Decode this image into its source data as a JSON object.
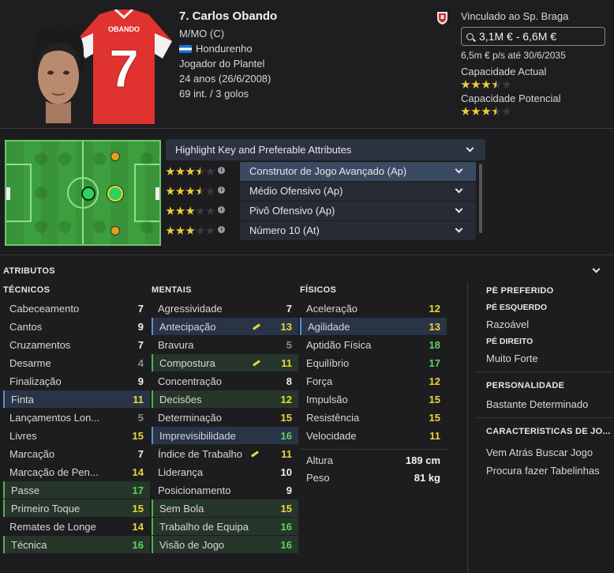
{
  "player": {
    "name": "7. Carlos Obando",
    "position": "M/MO (C)",
    "nationality": "Hondurenho",
    "status": "Jogador do Plantel",
    "age": "24 anos (26/6/2008)",
    "caps": "69 int. / 3 golos",
    "shirt_name": "OBANDO",
    "shirt_number": "7"
  },
  "contract": {
    "club_label": "Vinculado ao Sp. Braga",
    "value": "3,1M € - 6,6M €",
    "wage": "6,5m € p/s até 30/6/2035",
    "current_ability_label": "Capacidade Actual",
    "current_ability_stars": 3.5,
    "potential_ability_label": "Capacidade Potencial",
    "potential_ability_stars": 3.5
  },
  "roles": {
    "header": "Highlight Key and Preferable Attributes",
    "items": [
      {
        "name": "Construtor de Jogo Avançado (Ap)",
        "stars": 3.5,
        "selected": true
      },
      {
        "name": "Médio Ofensivo (Ap)",
        "stars": 3.5,
        "selected": false
      },
      {
        "name": "Pivô Ofensivo (Ap)",
        "stars": 3,
        "selected": false
      },
      {
        "name": "Número 10 (At)",
        "stars": 3,
        "selected": false
      }
    ]
  },
  "attributes": {
    "title": "ATRIBUTOS",
    "technical": {
      "title": "TÉCNICOS",
      "items": [
        {
          "name": "Cabeceamento",
          "value": "7",
          "color": "white",
          "hl": ""
        },
        {
          "name": "Cantos",
          "value": "9",
          "color": "white",
          "hl": ""
        },
        {
          "name": "Cruzamentos",
          "value": "7",
          "color": "white",
          "hl": ""
        },
        {
          "name": "Desarme",
          "value": "4",
          "color": "gray",
          "hl": ""
        },
        {
          "name": "Finalização",
          "value": "9",
          "color": "white",
          "hl": ""
        },
        {
          "name": "Finta",
          "value": "11",
          "color": "yellow",
          "hl": "blue"
        },
        {
          "name": "Lançamentos Lon...",
          "value": "5",
          "color": "gray",
          "hl": ""
        },
        {
          "name": "Livres",
          "value": "15",
          "color": "yellow",
          "hl": ""
        },
        {
          "name": "Marcação",
          "value": "7",
          "color": "white",
          "hl": ""
        },
        {
          "name": "Marcação de Pen...",
          "value": "14",
          "color": "yellow",
          "hl": ""
        },
        {
          "name": "Passe",
          "value": "17",
          "color": "green",
          "hl": "green"
        },
        {
          "name": "Primeiro Toque",
          "value": "15",
          "color": "yellow",
          "hl": "green"
        },
        {
          "name": "Remates de Longe",
          "value": "14",
          "color": "yellow",
          "hl": ""
        },
        {
          "name": "Técnica",
          "value": "16",
          "color": "green",
          "hl": "green"
        }
      ]
    },
    "mental": {
      "title": "MENTAIS",
      "items": [
        {
          "name": "Agressividade",
          "value": "7",
          "color": "white",
          "hl": "",
          "up": false
        },
        {
          "name": "Antecipação",
          "value": "13",
          "color": "yellow",
          "hl": "blue",
          "up": true
        },
        {
          "name": "Bravura",
          "value": "5",
          "color": "gray",
          "hl": "",
          "up": false
        },
        {
          "name": "Compostura",
          "value": "11",
          "color": "yellow",
          "hl": "green",
          "up": true
        },
        {
          "name": "Concentração",
          "value": "8",
          "color": "white",
          "hl": "",
          "up": false
        },
        {
          "name": "Decisões",
          "value": "12",
          "color": "yellow",
          "hl": "green",
          "up": false
        },
        {
          "name": "Determinação",
          "value": "15",
          "color": "yellow",
          "hl": "",
          "up": false
        },
        {
          "name": "Imprevisibilidade",
          "value": "16",
          "color": "green",
          "hl": "blue",
          "up": false
        },
        {
          "name": "Índice de Trabalho",
          "value": "11",
          "color": "yellow",
          "hl": "",
          "up": true
        },
        {
          "name": "Liderança",
          "value": "10",
          "color": "white",
          "hl": "",
          "up": false
        },
        {
          "name": "Posicionamento",
          "value": "9",
          "color": "white",
          "hl": "",
          "up": false
        },
        {
          "name": "Sem Bola",
          "value": "15",
          "color": "yellow",
          "hl": "green",
          "up": false
        },
        {
          "name": "Trabalho de Equipa",
          "value": "16",
          "color": "green",
          "hl": "green",
          "up": false
        },
        {
          "name": "Visão de Jogo",
          "value": "16",
          "color": "green",
          "hl": "green",
          "up": false
        }
      ]
    },
    "physical": {
      "title": "FÍSICOS",
      "items": [
        {
          "name": "Aceleração",
          "value": "12",
          "color": "yellow",
          "hl": ""
        },
        {
          "name": "Agilidade",
          "value": "13",
          "color": "yellow",
          "hl": "blue"
        },
        {
          "name": "Aptidão Física",
          "value": "18",
          "color": "green",
          "hl": ""
        },
        {
          "name": "Equilíbrio",
          "value": "17",
          "color": "green",
          "hl": ""
        },
        {
          "name": "Força",
          "value": "12",
          "color": "yellow",
          "hl": ""
        },
        {
          "name": "Impulsão",
          "value": "15",
          "color": "yellow",
          "hl": ""
        },
        {
          "name": "Resistência",
          "value": "15",
          "color": "yellow",
          "hl": ""
        },
        {
          "name": "Velocidade",
          "value": "11",
          "color": "yellow",
          "hl": ""
        }
      ],
      "height_label": "Altura",
      "height": "189 cm",
      "weight_label": "Peso",
      "weight": "81 kg"
    }
  },
  "side": {
    "foot_title": "PÉ PREFERIDO",
    "left_foot_label": "PÉ ESQUERDO",
    "left_foot_value": "Razoável",
    "right_foot_label": "PÉ DIREITO",
    "right_foot_value": "Muito Forte",
    "personality_title": "PERSONALIDADE",
    "personality_value": "Bastante Determinado",
    "traits_title": "CARACTERÍSTICAS DE JO...",
    "traits": [
      "Vem Atrás Buscar Jogo",
      "Procura fazer Tabelinhas"
    ]
  },
  "colors": {
    "star": "#f0cf3a",
    "green": "#5cd65c",
    "yellow": "#e8d83a",
    "gray": "#8a8a8e",
    "highlight_blue": "#5b8fd8",
    "highlight_green": "#4fb357"
  }
}
